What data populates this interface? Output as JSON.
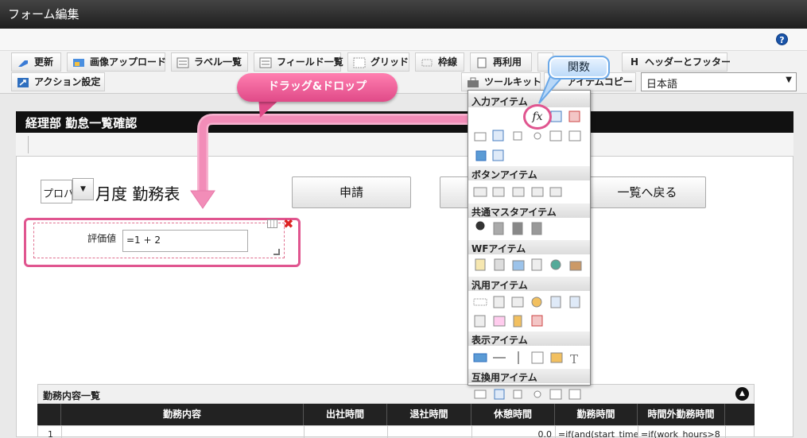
{
  "window": {
    "title": "フォーム編集",
    "help_label": "?"
  },
  "toolbar": {
    "row1": [
      {
        "label": "更新",
        "icon": "refresh-icon"
      },
      {
        "label": "画像アップロード",
        "icon": "image-upload-icon"
      },
      {
        "label": "ラベル一覧",
        "icon": "label-list-icon"
      },
      {
        "label": "フィールド一覧",
        "icon": "field-list-icon"
      },
      {
        "label": "グリッド",
        "icon": "grid-icon"
      },
      {
        "label": "枠線",
        "icon": "border-icon"
      },
      {
        "label": "再利用",
        "icon": "reuse-icon"
      },
      {
        "label": "ヘッダーとフッター",
        "icon": "header-footer-icon"
      }
    ],
    "row2": [
      {
        "label": "アクション設定",
        "icon": "action-icon"
      },
      {
        "label": "ツールキット",
        "icon": "toolkit-icon"
      },
      {
        "label": "アイテムコピー",
        "icon": "item-copy-icon"
      }
    ],
    "language": "日本語",
    "header_footer_prefix": "H"
  },
  "form": {
    "header": "経理部 勤怠一覧確認",
    "select_value": "プロパ",
    "title": "月度 勤務表",
    "buttons": [
      "申請",
      "",
      "一覧へ戻る"
    ],
    "field": {
      "label": "評価値",
      "value": "=1 + 2"
    }
  },
  "list": {
    "title": "勤務内容一覧",
    "columns": [
      "勤務内容",
      "出社時間",
      "退社時間",
      "休憩時間",
      "勤務時間",
      "時間外勤務時間"
    ],
    "rows": [
      [
        "1",
        "",
        "",
        "",
        "0.0",
        "=if(and(start_time>",
        "=if(work_hours>8"
      ]
    ]
  },
  "palette": {
    "sections": [
      "入力アイテム",
      "ボタンアイテム",
      "共通マスタアイテム",
      "WFアイテム",
      "汎用アイテム",
      "表示アイテム",
      "互換用アイテム"
    ],
    "fx_label": "fx"
  },
  "callouts": {
    "function": "関数",
    "drag_drop": "ドラッグ&ドロップ"
  },
  "colors": {
    "accent_pink": "#e0558f",
    "callout_blue": "#6aa8e8",
    "title_bar": "#1e1e1e"
  }
}
